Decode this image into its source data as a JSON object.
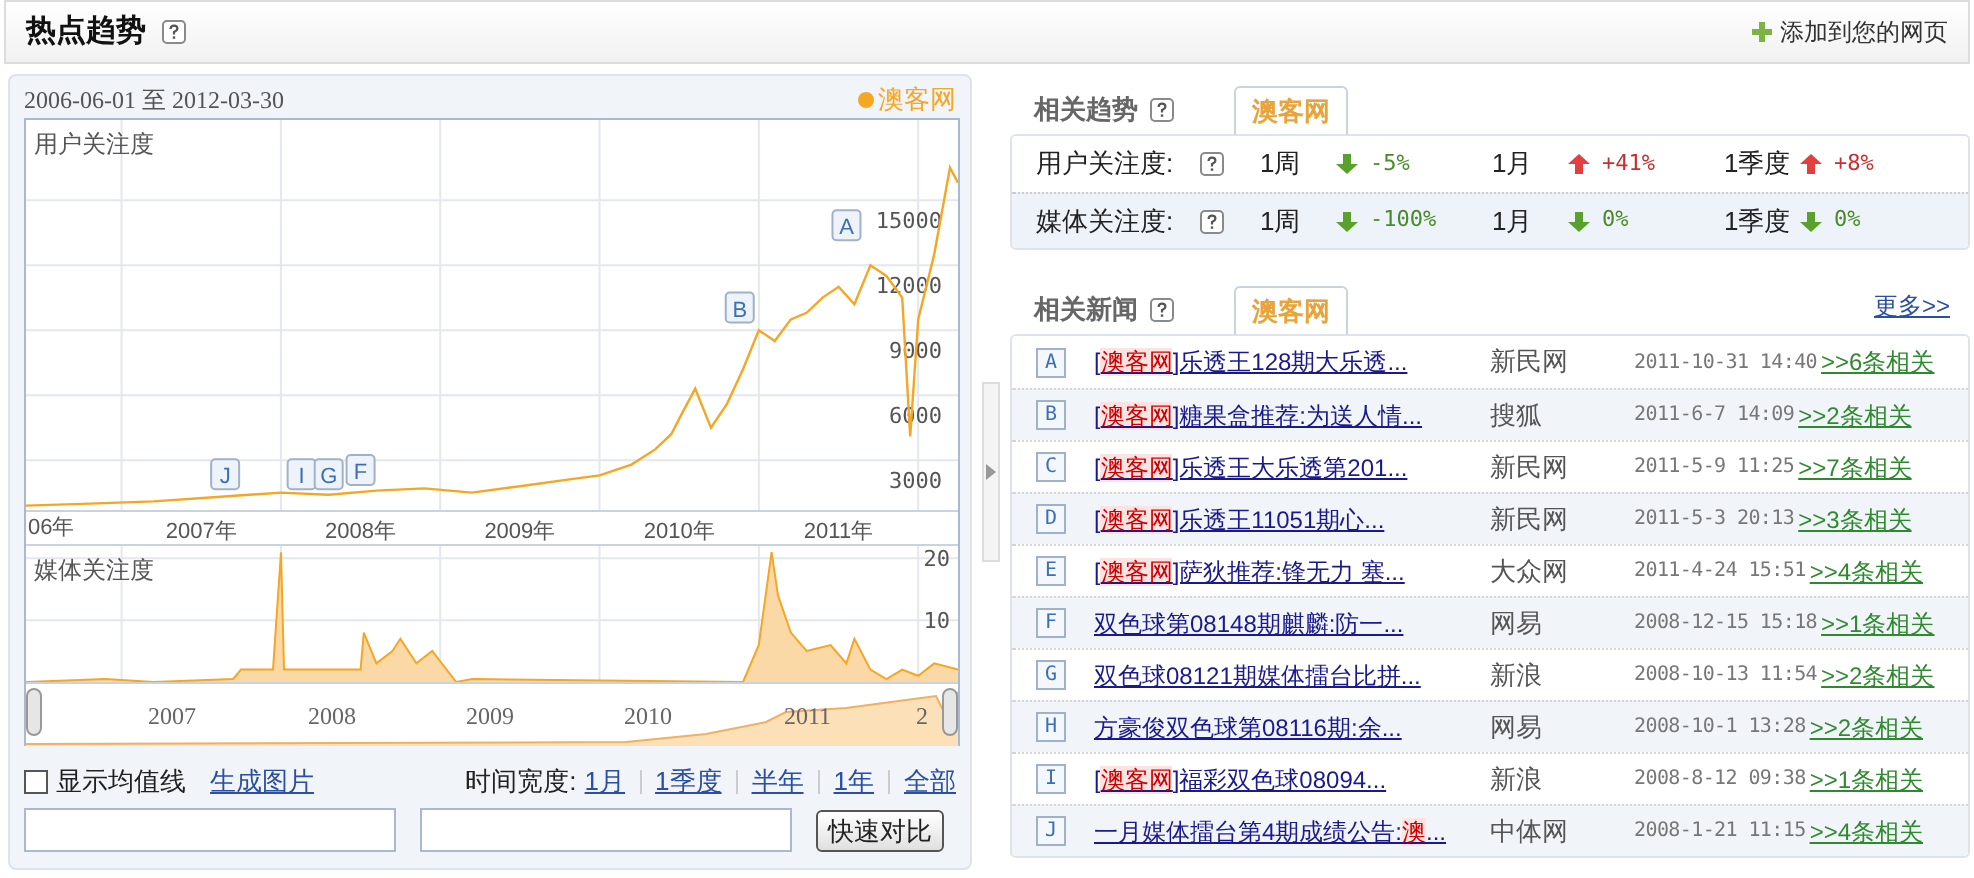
{
  "header": {
    "title": "热点趋势",
    "add_link": "添加到您的网页"
  },
  "left": {
    "date_range": "2006-06-01 至 2012-03-30",
    "user_chart": {
      "label": "用户关注度",
      "cut_year_label": "06年",
      "chart_data": {
        "type": "line",
        "grid": true,
        "xlim": [
          2006.4,
          2012.25
        ],
        "ylim": [
          700,
          18700
        ],
        "xticks": [
          {
            "value": 2007.5,
            "label": "2007年"
          },
          {
            "value": 2008.5,
            "label": "2008年"
          },
          {
            "value": 2009.5,
            "label": "2009年"
          },
          {
            "value": 2010.5,
            "label": "2010年"
          },
          {
            "value": 2011.5,
            "label": "2011年"
          }
        ],
        "yticks": [
          3000,
          6000,
          9000,
          12000,
          15000
        ],
        "x": [
          2006.4,
          2006.8,
          2007.2,
          2007.6,
          2008.0,
          2008.3,
          2008.6,
          2008.9,
          2009.2,
          2009.5,
          2009.8,
          2010.0,
          2010.2,
          2010.35,
          2010.45,
          2010.52,
          2010.6,
          2010.7,
          2010.8,
          2010.9,
          2011.0,
          2011.1,
          2011.2,
          2011.3,
          2011.4,
          2011.5,
          2011.6,
          2011.7,
          2011.8,
          2011.9,
          2011.95,
          2012.0,
          2012.1,
          2012.2,
          2012.25
        ],
        "series": [
          {
            "name": "澳客网",
            "color": "#f5a623",
            "values": [
              900,
              1000,
              1100,
              1300,
              1500,
              1400,
              1600,
              1700,
              1500,
              1800,
              2100,
              2300,
              2800,
              3500,
              4200,
              5200,
              6300,
              4500,
              5600,
              7200,
              9000,
              8500,
              9500,
              9800,
              10500,
              11000,
              10200,
              12000,
              11500,
              10500,
              4100,
              9500,
              12500,
              16500,
              15800
            ]
          }
        ],
        "annotations": [
          {
            "x": 2007.65,
            "y": 2300,
            "text": "J"
          },
          {
            "x": 2008.13,
            "y": 2300,
            "text": "I"
          },
          {
            "x": 2008.3,
            "y": 2300,
            "text": "G"
          },
          {
            "x": 2008.5,
            "y": 2500,
            "text": "F"
          },
          {
            "x": 2010.88,
            "y": 10000,
            "text": "B"
          },
          {
            "x": 2011.55,
            "y": 13800,
            "text": "A"
          }
        ]
      }
    },
    "media_chart": {
      "label": "媒体关注度",
      "chart_data": {
        "type": "area",
        "grid": true,
        "xlim": [
          2006.4,
          2012.25
        ],
        "ylim": [
          0,
          22
        ],
        "yticks": [
          10,
          20
        ],
        "x": [
          2006.4,
          2006.9,
          2007.2,
          2007.7,
          2007.75,
          2007.95,
          2008.0,
          2008.02,
          2008.4,
          2008.5,
          2008.52,
          2008.6,
          2008.7,
          2008.75,
          2008.85,
          2008.95,
          2009.1,
          2009.2,
          2010.9,
          2011.0,
          2011.08,
          2011.12,
          2011.2,
          2011.3,
          2011.45,
          2011.55,
          2011.6,
          2011.7,
          2011.8,
          2011.9,
          2012.0,
          2012.1,
          2012.25
        ],
        "series": [
          {
            "color": "#f5a623",
            "values": [
              0,
              0.5,
              0,
              0.5,
              2,
              2,
              21,
              2,
              2,
              2,
              8,
              3,
              5,
              7,
              3,
              5,
              0,
              0.5,
              0,
              6,
              21,
              14,
              8,
              5,
              6,
              3,
              7,
              2,
              0.5,
              2,
              1,
              3,
              2
            ]
          }
        ]
      }
    },
    "navigator": {
      "labels": [
        "2007",
        "2008",
        "2009",
        "2010",
        "2011",
        "2"
      ]
    },
    "controls": {
      "avg_line": {
        "label": "显示均值线",
        "checked": false
      },
      "image_link": "生成图片",
      "width_label": "时间宽度:",
      "width_options": [
        {
          "label": "1月",
          "selected": false
        },
        {
          "label": "1季度",
          "selected": false
        },
        {
          "label": "半年",
          "selected": false
        },
        {
          "label": "1年",
          "selected": false
        },
        {
          "label": "全部",
          "selected": false
        }
      ],
      "compare_button": "快速对比"
    }
  },
  "trends": {
    "title": "相关趋势",
    "tab": {
      "label": "澳客网",
      "selected": true
    },
    "rows": [
      {
        "label": "用户关注度:",
        "cells": [
          {
            "period": "1周",
            "rising": false,
            "value": "-5%"
          },
          {
            "period": "1月",
            "rising": true,
            "value": "+41%"
          },
          {
            "period": "1季度",
            "rising": true,
            "value": "+8%"
          }
        ]
      },
      {
        "label": "媒体关注度:",
        "cells": [
          {
            "period": "1周",
            "rising": false,
            "value": "-100%"
          },
          {
            "period": "1月",
            "rising": false,
            "value": "0%"
          },
          {
            "period": "1季度",
            "rising": false,
            "value": "0%"
          }
        ]
      }
    ]
  },
  "news": {
    "title": "相关新闻",
    "tab": {
      "label": "澳客网",
      "selected": true
    },
    "more": "更多>>",
    "items": [
      {
        "marker": "A",
        "segments": [
          {
            "text": "[",
            "highlight": false
          },
          {
            "text": "澳客网",
            "highlight": true
          },
          {
            "text": "]乐透王128期大乐透...",
            "highlight": false
          }
        ],
        "source": "新民网",
        "time": "2011-10-31 14:40",
        "related": ">>6条相关"
      },
      {
        "marker": "B",
        "segments": [
          {
            "text": "[",
            "highlight": false
          },
          {
            "text": "澳客网",
            "highlight": true
          },
          {
            "text": "]糖果盒推荐:为送人情...",
            "highlight": false
          }
        ],
        "source": "搜狐",
        "time": "2011-6-7 14:09",
        "related": ">>2条相关"
      },
      {
        "marker": "C",
        "segments": [
          {
            "text": "[",
            "highlight": false
          },
          {
            "text": "澳客网",
            "highlight": true
          },
          {
            "text": "]乐透王大乐透第201...",
            "highlight": false
          }
        ],
        "source": "新民网",
        "time": "2011-5-9 11:25",
        "related": ">>7条相关"
      },
      {
        "marker": "D",
        "segments": [
          {
            "text": "[",
            "highlight": false
          },
          {
            "text": "澳客网",
            "highlight": true
          },
          {
            "text": "]乐透王11051期心...",
            "highlight": false
          }
        ],
        "source": "新民网",
        "time": "2011-5-3 20:13",
        "related": ">>3条相关"
      },
      {
        "marker": "E",
        "segments": [
          {
            "text": "[",
            "highlight": false
          },
          {
            "text": "澳客网",
            "highlight": true
          },
          {
            "text": "]萨狄推荐:锋无力 塞...",
            "highlight": false
          }
        ],
        "source": "大众网",
        "time": "2011-4-24 15:51",
        "related": ">>4条相关"
      },
      {
        "marker": "F",
        "segments": [
          {
            "text": "双色球第08148期麒麟:防一...",
            "highlight": false
          }
        ],
        "source": "网易",
        "time": "2008-12-15 15:18",
        "related": ">>1条相关"
      },
      {
        "marker": "G",
        "segments": [
          {
            "text": "双色球08121期媒体擂台比拼...",
            "highlight": false
          }
        ],
        "source": "新浪",
        "time": "2008-10-13 11:54",
        "related": ">>2条相关"
      },
      {
        "marker": "H",
        "segments": [
          {
            "text": "方豪俊双色球第08116期:余...",
            "highlight": false
          }
        ],
        "source": "网易",
        "time": "2008-10-1 13:28",
        "related": ">>2条相关"
      },
      {
        "marker": "I",
        "segments": [
          {
            "text": "[",
            "highlight": false
          },
          {
            "text": "澳客网",
            "highlight": true
          },
          {
            "text": "]福彩双色球08094...",
            "highlight": false
          }
        ],
        "source": "新浪",
        "time": "2008-8-12 09:38",
        "related": ">>1条相关"
      },
      {
        "marker": "J",
        "segments": [
          {
            "text": "一月媒体擂台第4期成绩公告:",
            "highlight": false
          },
          {
            "text": "澳",
            "highlight": true
          },
          {
            "text": "...",
            "highlight": false
          }
        ],
        "source": "中体网",
        "time": "2008-1-21 11:15",
        "related": ">>4条相关"
      }
    ]
  }
}
